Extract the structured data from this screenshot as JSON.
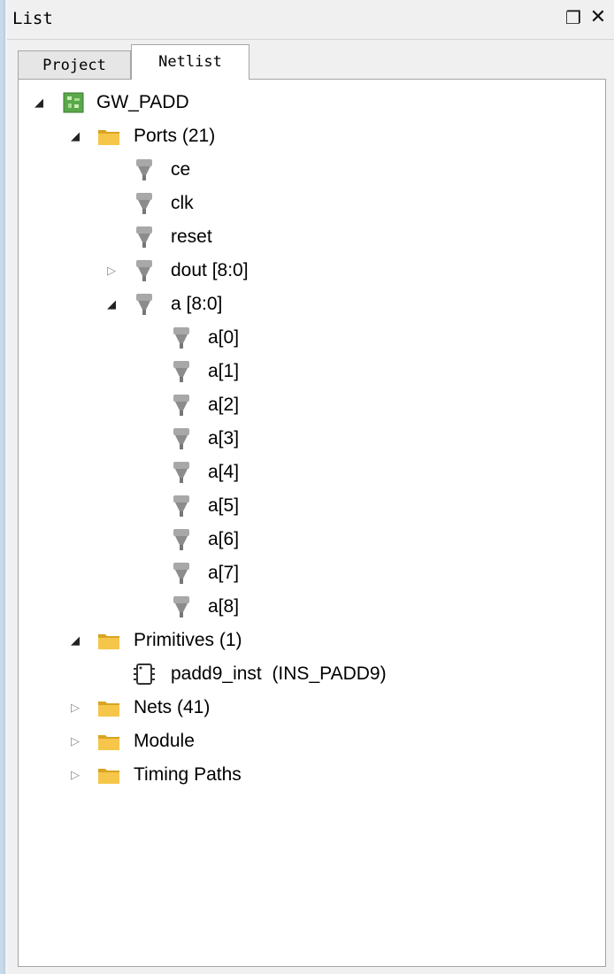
{
  "panel": {
    "title": "List",
    "float_icon": "float-window-icon",
    "close_icon": "close-icon"
  },
  "tabs": [
    {
      "label": "Project",
      "active": false
    },
    {
      "label": "Netlist",
      "active": true
    }
  ],
  "tree": {
    "root": {
      "label": "GW_PADD",
      "icon": "module-chip-icon",
      "expanded": true
    },
    "ports": {
      "label": "Ports (21)",
      "icon": "folder-icon",
      "expanded": true
    },
    "port_items": [
      {
        "label": "ce",
        "icon": "port-icon"
      },
      {
        "label": "clk",
        "icon": "port-icon"
      },
      {
        "label": "reset",
        "icon": "port-icon"
      }
    ],
    "dout": {
      "label": "dout [8:0]",
      "icon": "port-icon",
      "expanded": false
    },
    "a_bus": {
      "label": "a [8:0]",
      "icon": "port-icon",
      "expanded": true
    },
    "a_bits": [
      "a[0]",
      "a[1]",
      "a[2]",
      "a[3]",
      "a[4]",
      "a[5]",
      "a[6]",
      "a[7]",
      "a[8]"
    ],
    "primitives": {
      "label": "Primitives (1)",
      "icon": "folder-icon",
      "expanded": true
    },
    "primitive_item": {
      "name": "padd9_inst",
      "type": "(INS_PADD9)",
      "icon": "primitive-icon"
    },
    "nets": {
      "label": "Nets (41)",
      "icon": "folder-icon",
      "expanded": false
    },
    "module": {
      "label": "Module",
      "icon": "folder-icon",
      "expanded": false
    },
    "timing": {
      "label": "Timing Paths",
      "icon": "folder-icon",
      "expanded": false
    }
  },
  "colors": {
    "folder": "#f5c64a",
    "folder_dark": "#d9a421",
    "port": "#9a9a9a",
    "root_green": "#5aa84a"
  }
}
